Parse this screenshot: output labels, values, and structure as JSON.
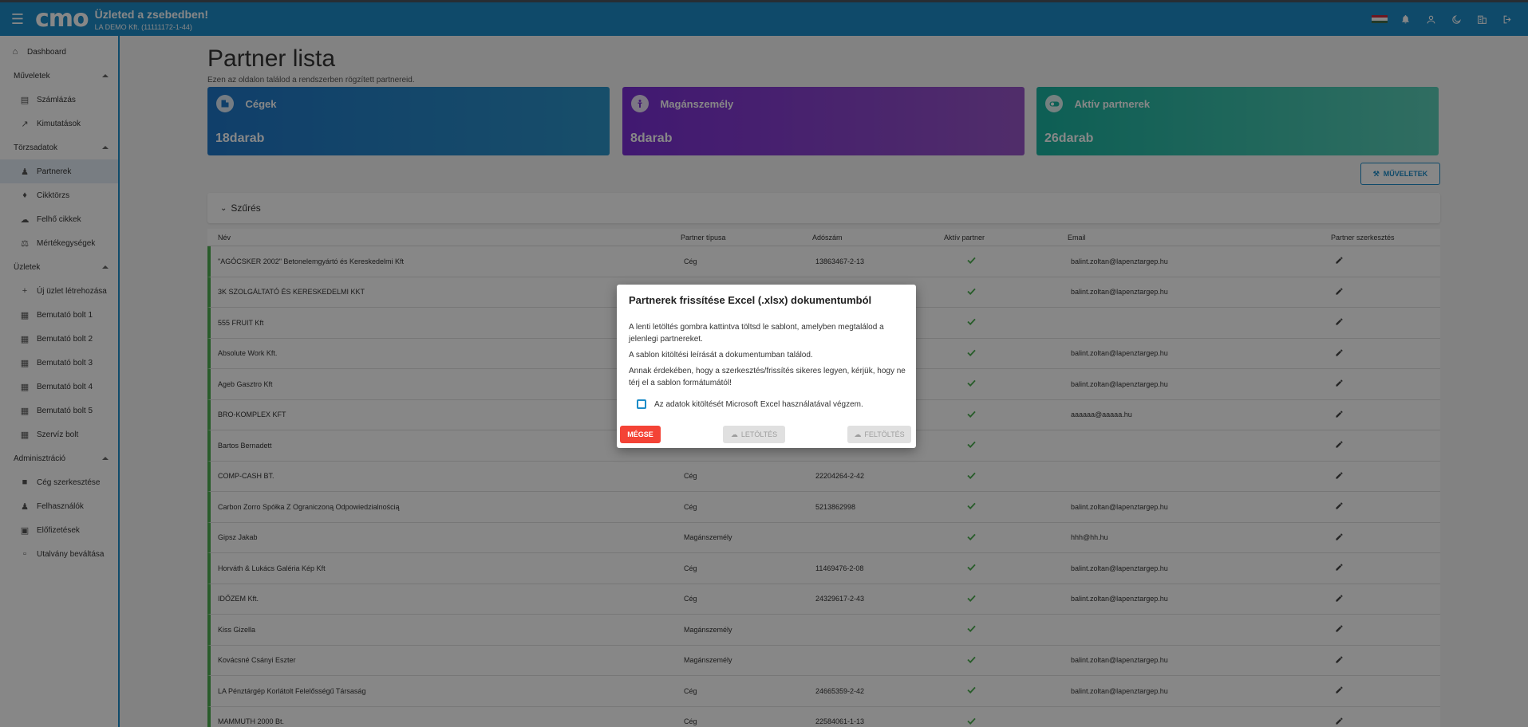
{
  "header": {
    "logo": "cmo",
    "title": "Üzleted a zsebedben!",
    "subtitle": "LA DEMO Kft. (11111172-1-44)",
    "flag_colors": [
      "#cd2a3e",
      "#ffffff",
      "#436f4d"
    ]
  },
  "sidebar": {
    "dashboard": "Dashboard",
    "groups": [
      {
        "label": "Műveletek",
        "items": [
          "Számlázás",
          "Kimutatások"
        ]
      },
      {
        "label": "Törzsadatok",
        "items": [
          "Partnerek",
          "Cikktörzs",
          "Felhő cikkek",
          "Mértékegységek"
        ]
      },
      {
        "label": "Üzletek",
        "items": [
          "Új üzlet létrehozása",
          "Bemutató bolt 1",
          "Bemutató bolt 2",
          "Bemutató bolt 3",
          "Bemutató bolt 4",
          "Bemutató bolt 5",
          "Szervíz bolt"
        ]
      },
      {
        "label": "Adminisztráció",
        "items": [
          "Cég szerkesztése",
          "Felhasználók",
          "Előfizetések",
          "Utalvány beváltása"
        ]
      }
    ]
  },
  "page": {
    "title": "Partner lista",
    "description": "Ezen az oldalon találod a rendszerben rögzített partnereid."
  },
  "stats": [
    {
      "label": "Cégek",
      "value": "18darab"
    },
    {
      "label": "Magánszemély",
      "value": "8darab"
    },
    {
      "label": "Aktív partnerek",
      "value": "26darab"
    }
  ],
  "ops_button": "MŰVELETEK",
  "filter_label": "Szűrés",
  "table": {
    "headers": [
      "Név",
      "Partner típusa",
      "Adószám",
      "Aktív partner",
      "Email",
      "Partner szerkesztés"
    ],
    "rows": [
      [
        "\"AGÓCSKER 2002\" Betonelemgyártó és Kereskedelmi Kft",
        "Cég",
        "13863467-2-13",
        "balint.zoltan@lapenztargep.hu"
      ],
      [
        "3K SZOLGÁLTATÓ ÉS KERESKEDELMI KKT",
        "",
        "",
        "balint.zoltan@lapenztargep.hu"
      ],
      [
        "555 FRUIT Kft",
        "",
        "",
        ""
      ],
      [
        "Absolute Work Kft.",
        "",
        "",
        "balint.zoltan@lapenztargep.hu"
      ],
      [
        "Ageb Gasztro Kft",
        "",
        "",
        "balint.zoltan@lapenztargep.hu"
      ],
      [
        "BRO-KOMPLEX KFT",
        "",
        "",
        "aaaaaa@aaaaa.hu"
      ],
      [
        "Bartos Bernadett",
        "",
        "",
        ""
      ],
      [
        "COMP-CASH BT.",
        "Cég",
        "22204264-2-42",
        ""
      ],
      [
        "Carbon Zorro Spółka Z Ograniczoną Odpowiedzialnością",
        "Cég",
        "5213862998",
        "balint.zoltan@lapenztargep.hu"
      ],
      [
        "Gipsz Jakab",
        "Magánszemély",
        "",
        "hhh@hh.hu"
      ],
      [
        "Horváth & Lukács Galéria Kép Kft",
        "Cég",
        "11469476-2-08",
        "balint.zoltan@lapenztargep.hu"
      ],
      [
        "IDŐZEM Kft.",
        "Cég",
        "24329617-2-43",
        "balint.zoltan@lapenztargep.hu"
      ],
      [
        "Kiss Gizella",
        "Magánszemély",
        "",
        ""
      ],
      [
        "Kovácsné Csányi Eszter",
        "Magánszemély",
        "",
        "balint.zoltan@lapenztargep.hu"
      ],
      [
        "LA Pénztárgép Korlátolt Felelősségű Társaság",
        "Cég",
        "24665359-2-42",
        "balint.zoltan@lapenztargep.hu"
      ],
      [
        "MAMMUTH 2000 Bt.",
        "Cég",
        "22584061-1-13",
        ""
      ]
    ]
  },
  "dialog": {
    "title": "Partnerek frissítése Excel (.xlsx) dokumentumból",
    "p1": "A lenti letöltés gombra kattintva töltsd le sablont, amelyben megtalálod a jelenlegi partnereket.",
    "p2": "A sablon kitöltési leírását a dokumentumban találod.",
    "p3": "Annak érdekében, hogy a szerkesztés/frissítés sikeres legyen, kérjük, hogy ne térj el a sablon formátumától!",
    "checkbox_label": "Az adatok kitöltését Microsoft Excel használatával végzem.",
    "cancel": "MÉGSE",
    "download": "LETÖLTÉS",
    "upload": "FELTÖLTÉS"
  }
}
